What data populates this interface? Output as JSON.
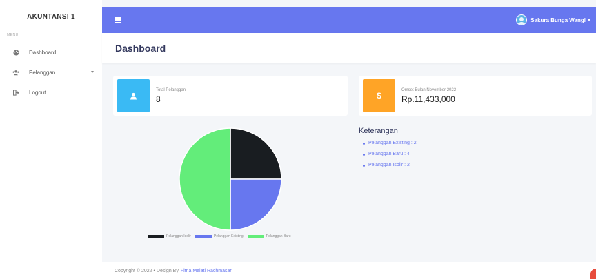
{
  "sidebar": {
    "brand": "AKUNTANSI 1",
    "menu_header": "MENU",
    "items": [
      {
        "label": "Dashboard",
        "icon": "palette-icon"
      },
      {
        "label": "Pelanggan",
        "icon": "users-icon"
      },
      {
        "label": "Logout",
        "icon": "logout-icon"
      }
    ]
  },
  "topbar": {
    "user_name": "Sakura Bunga Wangi"
  },
  "page": {
    "title": "Dashboard"
  },
  "cards": {
    "pelanggan": {
      "label": "Total Pelanggan",
      "value": "8",
      "color": "#3abaf4",
      "icon": "user-icon"
    },
    "omset": {
      "label": "Omset Bulan November 2022",
      "value": "Rp.11,433,000",
      "color": "#ffa426",
      "icon": "dollar-icon",
      "symbol": "$"
    }
  },
  "chart_data": {
    "type": "pie",
    "categories": [
      "Pelanggan Isolir",
      "Pelanggan Existing",
      "Pelanggan Baru"
    ],
    "values": [
      2,
      2,
      4
    ],
    "colors": [
      "#191d21",
      "#6777ef",
      "#63ed7a"
    ],
    "legend": "bottom"
  },
  "keterangan": {
    "title": "Keterangan",
    "items": [
      "Pelanggan Existing : 2",
      "Pelanggan Baru : 4",
      "Pelanggan Isolir : 2"
    ]
  },
  "footer": {
    "text": "Copyright © 2022  •  Design By",
    "author": "Fitria Melati Rachmasari"
  },
  "colors": {
    "primary": "#6777ef",
    "sidebar_bg": "#ffffff",
    "page_bg": "#f4f6f9"
  }
}
